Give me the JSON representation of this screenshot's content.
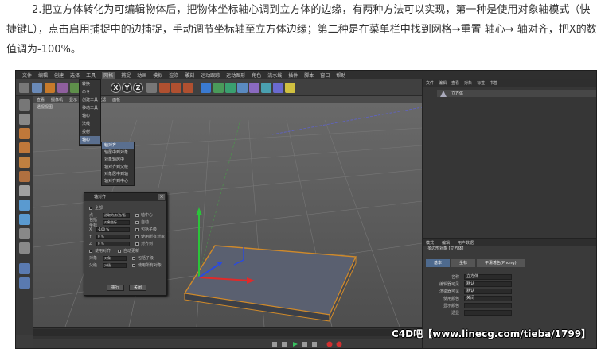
{
  "article": {
    "paragraph": "2.把立方体转化为可编辑物体后，把物体坐标轴心调到立方体的边缘，有两种方法可以实现，第一种是使用对象轴模式（快捷键L），点击启用捕捉中的边捕捉，手动调节坐标轴至立方体边缘；第二种是在菜单栏中找到网格→重置 轴心→ 轴对齐，把X的数值调为-100%。"
  },
  "app": {
    "menu": [
      "文件",
      "编辑",
      "创建",
      "选择",
      "工具",
      "网格",
      "捕捉",
      "动画",
      "模拟",
      "渲染",
      "雕刻",
      "运动跟踪",
      "运动图形",
      "角色",
      "流水线",
      "插件",
      "脚本",
      "窗口",
      "帮助"
    ],
    "active_menu": "网格",
    "menu_dropdown": [
      "转换",
      "命令",
      "创建工具",
      "移动工具",
      "轴心",
      "法线",
      "投射",
      "轴心",
      "重置轴心"
    ],
    "submenu": [
      "轴对齐",
      "轴居中到对象",
      "对象轴居中",
      "轴对齐到父级",
      "对象居中到轴",
      "轴对齐到中心"
    ],
    "axis_buttons": [
      "X",
      "Y",
      "Z"
    ],
    "viewport": {
      "tabs": [
        "查看",
        "摄像机",
        "显示",
        "选项",
        "过滤",
        "面板"
      ],
      "label": "透视视图"
    },
    "object_panel": {
      "tabs": [
        "文件",
        "编辑",
        "查看",
        "对象",
        "标签",
        "书签"
      ],
      "object_name": "立方体"
    },
    "attributes_panel": {
      "tabs": [
        "模式",
        "编辑",
        "用户数据"
      ],
      "object_line": "多边形对象 [立方体]",
      "subtabs": [
        "基本",
        "坐标",
        "平滑着色(Phong)"
      ],
      "rows": [
        {
          "label": "名称",
          "value": "立方体"
        },
        {
          "label": "编辑器可见",
          "value": "默认"
        },
        {
          "label": "渲染器可见",
          "value": "默认"
        },
        {
          "label": "使用颜色",
          "value": "关闭"
        },
        {
          "label": "显示颜色",
          "value": ""
        },
        {
          "label": "透显",
          "value": ""
        }
      ]
    },
    "dialog": {
      "title": "轴对齐",
      "checkbox_all": "全部",
      "points_label": "点",
      "points_value": "选取的点/边/面",
      "polygons_label": "包括坐标",
      "polygons_value": "对象坐标",
      "x_label": "X",
      "x_value": "-100 %",
      "y_label": "Y",
      "y_value": "0 %",
      "z_label": "Z",
      "z_value": "0 %",
      "center_label": "轴中心",
      "side_options": [
        "自动",
        "包括子级",
        "使用所有对象",
        "对齐到"
      ],
      "check_options": [
        "使用对齐",
        "自动更新",
        "包括子级",
        "使用所有对象"
      ],
      "other_label": "对象",
      "other_value": "对象",
      "parent_label": "父级",
      "parent_value": "父级",
      "btn_apply": "执行",
      "btn_close": "关闭"
    }
  },
  "watermark": "C4D吧【www.linecg.com/tieba/1799】"
}
